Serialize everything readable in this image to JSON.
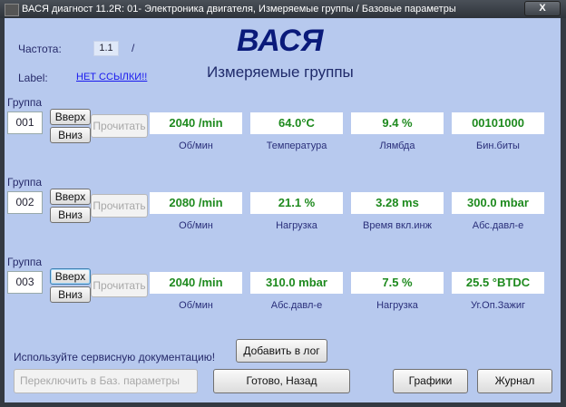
{
  "window": {
    "title": "ВАСЯ диагност 11.2R: 01- Электроника двигателя,  Измеряемые группы / Базовые параметры",
    "close": "X"
  },
  "header": {
    "freq_label": "Частота:",
    "freq_value": "1.1",
    "freq_sep": "/",
    "label_label": "Label:",
    "label_link": "НЕТ ССЫЛКИ!!",
    "logo": "ВАСЯ",
    "subtitle": "Измеряемые группы"
  },
  "groups": [
    {
      "label": "Группа",
      "number": "001",
      "up": "Вверх",
      "down": "Вниз",
      "read": "Прочитать",
      "values": [
        {
          "v": "2040 /min",
          "c": "Об/мин"
        },
        {
          "v": "64.0°C",
          "c": "Температура"
        },
        {
          "v": "9.4 %",
          "c": "Лямбда"
        },
        {
          "v": "00101000",
          "c": "Бин.биты"
        }
      ]
    },
    {
      "label": "Группа",
      "number": "002",
      "up": "Вверх",
      "down": "Вниз",
      "read": "Прочитать",
      "values": [
        {
          "v": "2080 /min",
          "c": "Об/мин"
        },
        {
          "v": "21.1 %",
          "c": "Нагрузка"
        },
        {
          "v": "3.28 ms",
          "c": "Время вкл.инж"
        },
        {
          "v": "300.0 mbar",
          "c": "Абс.давл-е"
        }
      ]
    },
    {
      "label": "Группа",
      "number": "003",
      "up": "Вверх",
      "down": "Вниз",
      "read": "Прочитать",
      "values": [
        {
          "v": "2040 /min",
          "c": "Об/мин"
        },
        {
          "v": "310.0 mbar",
          "c": "Абс.давл-е"
        },
        {
          "v": "7.5 %",
          "c": "Нагрузка"
        },
        {
          "v": "25.5 °BTDC",
          "c": "Уг.Оп.Зажиг"
        }
      ]
    }
  ],
  "footer": {
    "notice": "Используйте сервисную документацию!",
    "add_log": "Добавить в лог",
    "switch_basic": "Переключить в Баз. параметры",
    "done_back": "Готово, Назад",
    "graphs": "Графики",
    "journal": "Журнал"
  }
}
